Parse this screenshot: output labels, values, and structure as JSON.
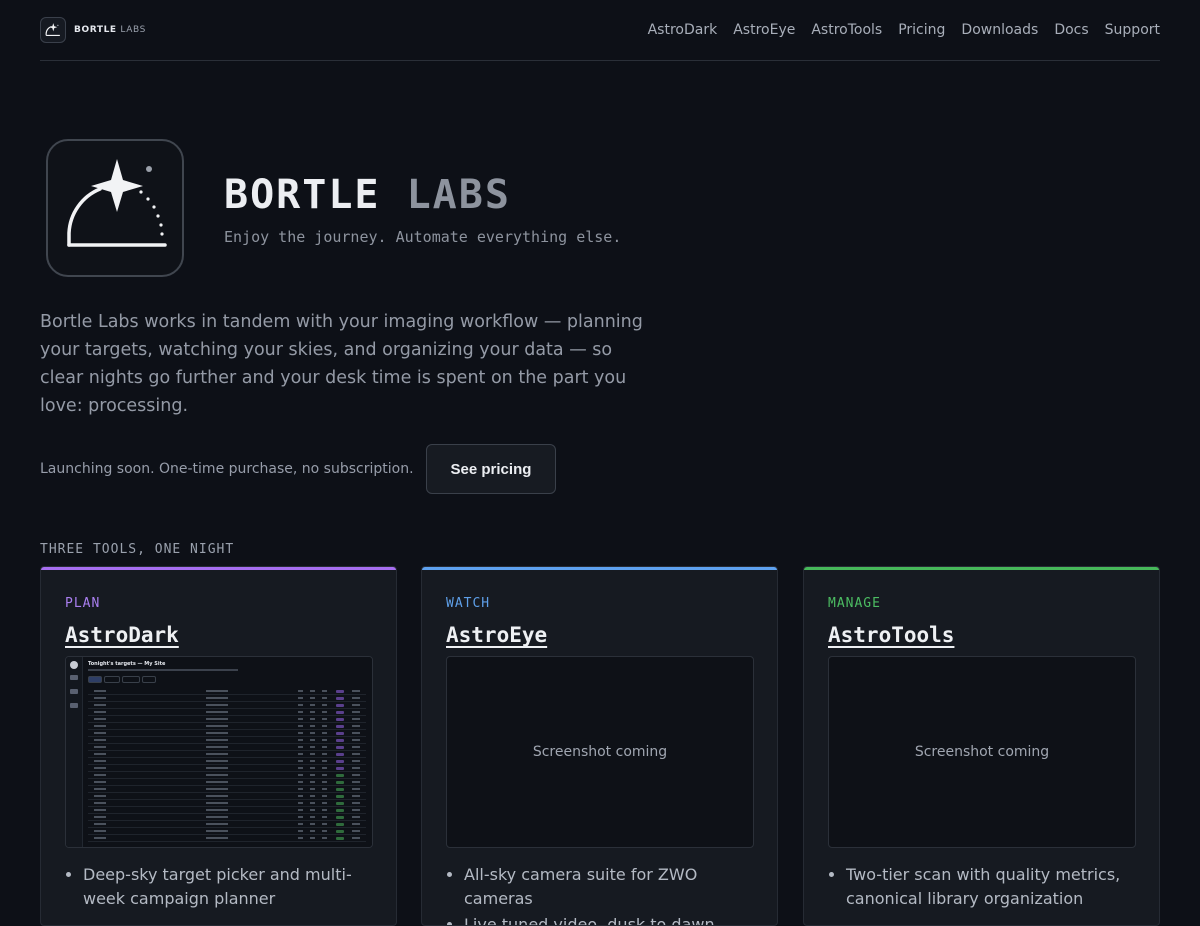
{
  "header": {
    "brand_strong": "BORTLE",
    "brand_dim": "LABS",
    "nav": [
      "AstroDark",
      "AstroEye",
      "AstroTools",
      "Pricing",
      "Downloads",
      "Docs",
      "Support"
    ]
  },
  "hero": {
    "title_strong": "BORTLE",
    "title_dim": "LABS",
    "tagline": "Enjoy the journey. Automate everything else.",
    "intro": "Bortle Labs works in tandem with your imaging workflow — planning your targets, watching your skies, and organizing your data — so clear nights go further and your desk time is spent on the part you love: processing.",
    "cta_note": "Launching soon. One-time purchase, no subscription.",
    "cta_button": "See pricing"
  },
  "section_label": "THREE TOOLS, ONE NIGHT",
  "cards": [
    {
      "category": "PLAN",
      "title": "AstroDark",
      "accent": "#a66ef0",
      "category_color": "#a97ff0",
      "screenshot": {
        "title": "Tonight's targets — My Site"
      },
      "bullets": [
        "Deep-sky target picker and multi-week campaign planner"
      ]
    },
    {
      "category": "WATCH",
      "title": "AstroEye",
      "accent": "#5ea2f0",
      "category_color": "#5e9fe8",
      "screenshot_placeholder": "Screenshot coming",
      "bullets": [
        "All-sky camera suite for ZWO cameras",
        "Live tuned video, dusk to dawn"
      ]
    },
    {
      "category": "MANAGE",
      "title": "AstroTools",
      "accent": "#46b85a",
      "category_color": "#4cbc62",
      "screenshot_placeholder": "Screenshot coming",
      "bullets": [
        "Two-tier scan with quality metrics, canonical library organization"
      ]
    }
  ]
}
